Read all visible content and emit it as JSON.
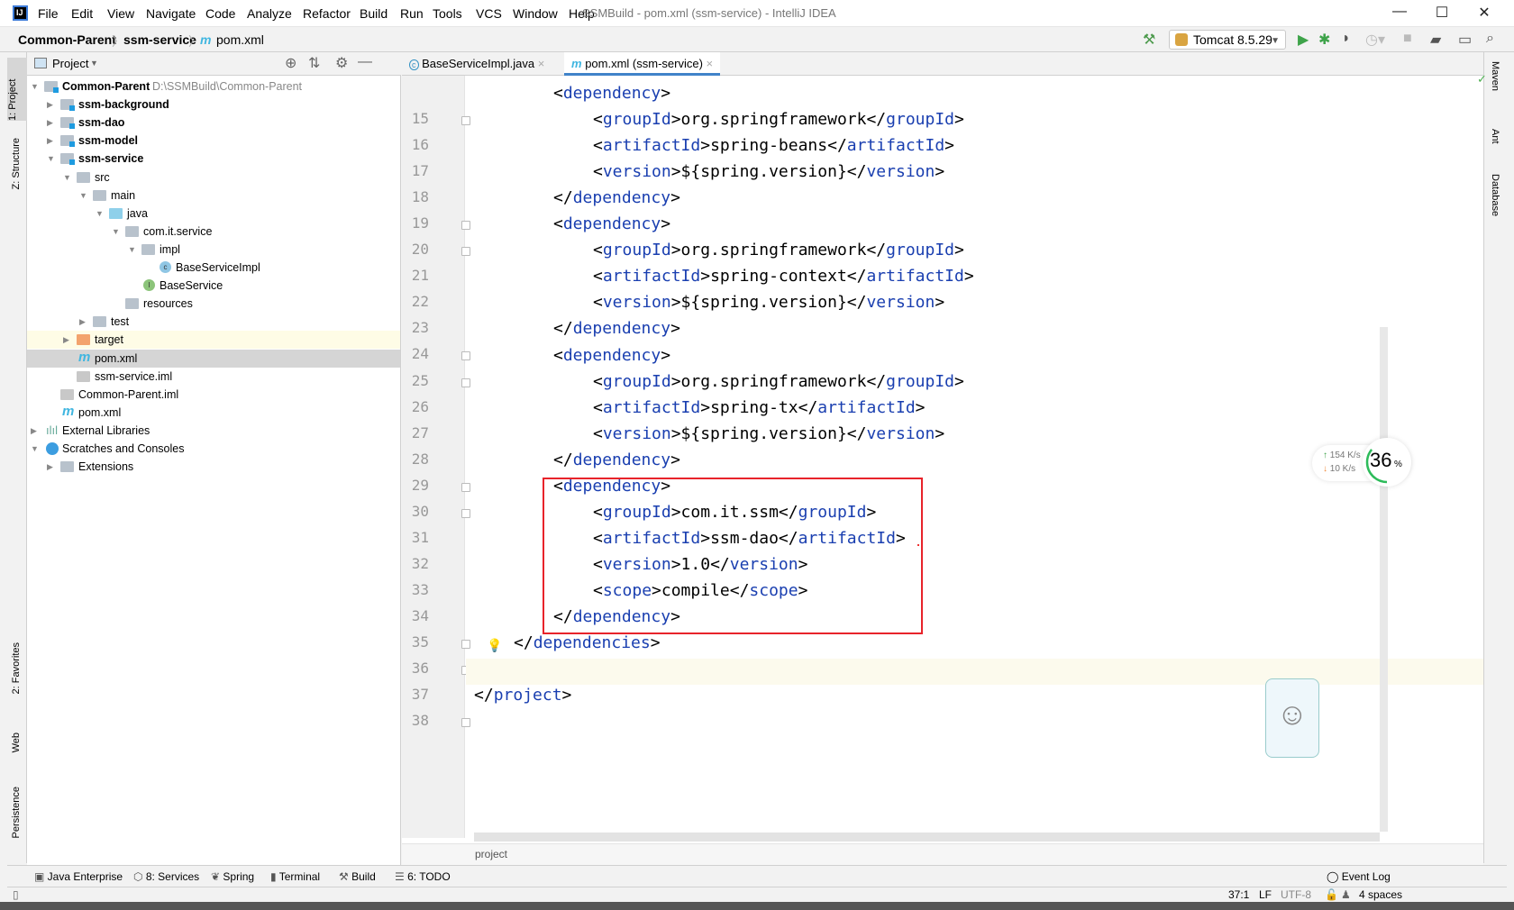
{
  "window": {
    "title": "SSMBuild - pom.xml (ssm-service) - IntelliJ IDEA",
    "logo": "IJ",
    "min": "—",
    "max": "☐",
    "close": "✕"
  },
  "menu": [
    "File",
    "Edit",
    "View",
    "Navigate",
    "Code",
    "Analyze",
    "Refactor",
    "Build",
    "Run",
    "Tools",
    "VCS",
    "Window",
    "Help"
  ],
  "breadcrumb": [
    "Common-Parent",
    "ssm-service",
    "pom.xml"
  ],
  "toolbar": {
    "run_config": "Tomcat 8.5.29"
  },
  "left_stripe": [
    "1: Project",
    "Z: Structure",
    "2: Favorites",
    "Web",
    "Persistence"
  ],
  "right_stripe": [
    "Maven",
    "Ant",
    "Database"
  ],
  "project": {
    "title": "Project",
    "tree": [
      {
        "level": 0,
        "arrow": "down",
        "icon": "module",
        "label": "Common-Parent",
        "bold": true,
        "path": "D:\\SSMBuild\\Common-Parent"
      },
      {
        "level": 1,
        "arrow": "right",
        "icon": "module",
        "label": "ssm-background",
        "bold": true
      },
      {
        "level": 1,
        "arrow": "right",
        "icon": "module",
        "label": "ssm-dao",
        "bold": true
      },
      {
        "level": 1,
        "arrow": "right",
        "icon": "module",
        "label": "ssm-model",
        "bold": true
      },
      {
        "level": 1,
        "arrow": "down",
        "icon": "module",
        "label": "ssm-service",
        "bold": true
      },
      {
        "level": 2,
        "arrow": "down",
        "icon": "folder",
        "label": "src"
      },
      {
        "level": 3,
        "arrow": "down",
        "icon": "folder",
        "label": "main"
      },
      {
        "level": 4,
        "arrow": "down",
        "icon": "source",
        "label": "java"
      },
      {
        "level": 5,
        "arrow": "down",
        "icon": "package",
        "label": "com.it.service"
      },
      {
        "level": 6,
        "arrow": "down",
        "icon": "package",
        "label": "impl"
      },
      {
        "level": 7,
        "arrow": "",
        "icon": "class",
        "label": "BaseServiceImpl"
      },
      {
        "level": 6,
        "arrow": "",
        "icon": "interface",
        "label": "BaseService"
      },
      {
        "level": 5,
        "arrow": "",
        "icon": "resources",
        "label": "resources"
      },
      {
        "level": 3,
        "arrow": "right",
        "icon": "folder",
        "label": "test"
      },
      {
        "level": 2,
        "arrow": "right",
        "icon": "excluded",
        "label": "target",
        "highlight": true
      },
      {
        "level": 2,
        "arrow": "",
        "icon": "maven",
        "label": "pom.xml",
        "selected": true
      },
      {
        "level": 2,
        "arrow": "",
        "icon": "iml",
        "label": "ssm-service.iml"
      },
      {
        "level": 1,
        "arrow": "",
        "icon": "iml",
        "label": "Common-Parent.iml"
      },
      {
        "level": 1,
        "arrow": "",
        "icon": "maven",
        "label": "pom.xml"
      },
      {
        "level": 0,
        "arrow": "right",
        "icon": "libraries",
        "label": "External Libraries"
      },
      {
        "level": 0,
        "arrow": "down",
        "icon": "scratches",
        "label": "Scratches and Consoles"
      },
      {
        "level": 1,
        "arrow": "right",
        "icon": "folder",
        "label": "Extensions"
      }
    ]
  },
  "tabs": [
    {
      "label": "BaseServiceImpl.java",
      "icon": "class"
    },
    {
      "label": "pom.xml (ssm-service)",
      "icon": "maven",
      "active": true
    }
  ],
  "code": [
    {
      "n": 15,
      "indent": 2,
      "open": "dependency"
    },
    {
      "n": 16,
      "indent": 3,
      "tag": "groupId",
      "value": "org.springframework"
    },
    {
      "n": 17,
      "indent": 3,
      "tag": "artifactId",
      "value": "spring-beans"
    },
    {
      "n": 18,
      "indent": 3,
      "tag": "version",
      "value": "${spring.version}"
    },
    {
      "n": 19,
      "indent": 2,
      "close": "dependency"
    },
    {
      "n": 20,
      "indent": 2,
      "open": "dependency"
    },
    {
      "n": 21,
      "indent": 3,
      "tag": "groupId",
      "value": "org.springframework"
    },
    {
      "n": 22,
      "indent": 3,
      "tag": "artifactId",
      "value": "spring-context"
    },
    {
      "n": 23,
      "indent": 3,
      "tag": "version",
      "value": "${spring.version}"
    },
    {
      "n": 24,
      "indent": 2,
      "close": "dependency"
    },
    {
      "n": 25,
      "indent": 2,
      "open": "dependency"
    },
    {
      "n": 26,
      "indent": 3,
      "tag": "groupId",
      "value": "org.springframework"
    },
    {
      "n": 27,
      "indent": 3,
      "tag": "artifactId",
      "value": "spring-tx"
    },
    {
      "n": 28,
      "indent": 3,
      "tag": "version",
      "value": "${spring.version}"
    },
    {
      "n": 29,
      "indent": 2,
      "close": "dependency"
    },
    {
      "n": 30,
      "indent": 2,
      "open": "dependency"
    },
    {
      "n": 31,
      "indent": 3,
      "tag": "groupId",
      "value": "com.it.ssm"
    },
    {
      "n": 32,
      "indent": 3,
      "tag": "artifactId",
      "value": "ssm-dao"
    },
    {
      "n": 33,
      "indent": 3,
      "tag": "version",
      "value": "1.0"
    },
    {
      "n": 34,
      "indent": 3,
      "tag": "scope",
      "value": "compile"
    },
    {
      "n": 35,
      "indent": 2,
      "close": "dependency"
    },
    {
      "n": 36,
      "indent": 1,
      "close": "dependencies"
    },
    {
      "n": 37,
      "indent": 0,
      "current": true
    },
    {
      "n": 38,
      "indent": 0,
      "close": "project"
    }
  ],
  "editor_breadcrumb": "project",
  "network_widget": {
    "upload": "154 K/s",
    "download": "10  K/s",
    "percent": "36",
    "percent_sign": "%",
    "level": 0.36
  },
  "bottom_tools": [
    "Java Enterprise",
    "8: Services",
    "Spring",
    "Terminal",
    "Build",
    "6: TODO"
  ],
  "event_log": "Event Log",
  "status": {
    "position": "37:1",
    "line_sep": "LF",
    "encoding": "UTF-8",
    "indent": "4 spaces"
  },
  "colors": {
    "tag": "#1a3fb0",
    "highlight_box": "#e8232a",
    "current_line": "#fcfaed",
    "tab_underline": "#4083c9"
  }
}
